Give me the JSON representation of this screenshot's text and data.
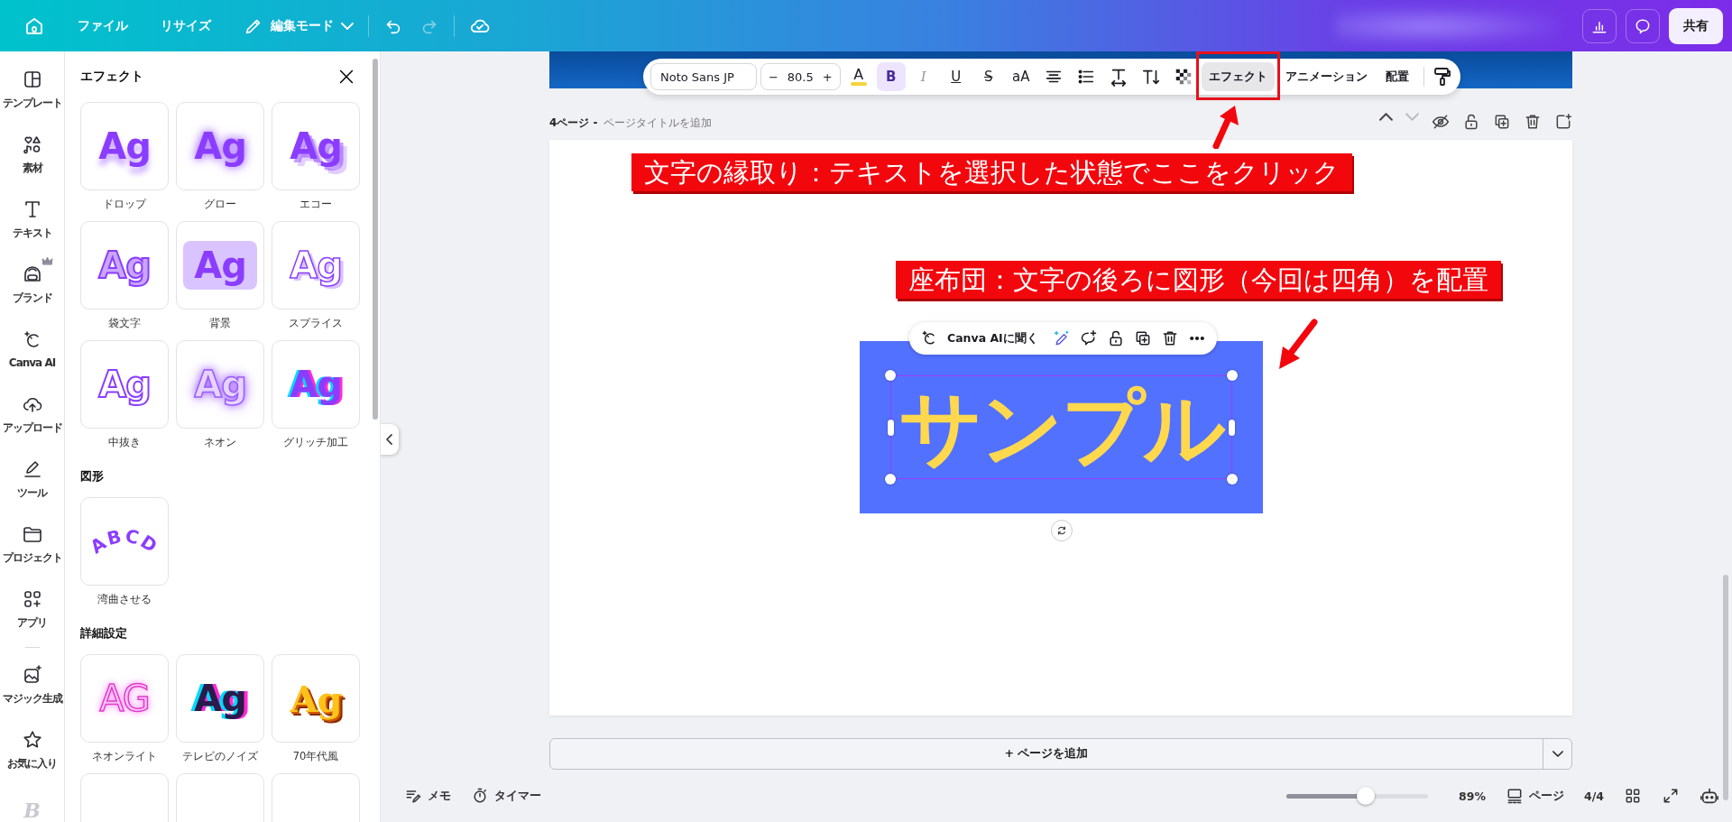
{
  "top_bar": {
    "menus": [
      "ファイル",
      "リサイズ"
    ],
    "edit_mode": "編集モード",
    "share": "共有"
  },
  "rail": {
    "items": [
      {
        "kind": "templates",
        "label": "テンプレート",
        "premium": false
      },
      {
        "kind": "elements",
        "label": "素材",
        "premium": false
      },
      {
        "kind": "text",
        "label": "テキスト",
        "premium": false
      },
      {
        "kind": "brand",
        "label": "ブランド",
        "premium": true
      },
      {
        "kind": "ai",
        "label": "Canva AI",
        "premium": false
      },
      {
        "kind": "upload",
        "label": "アップロード",
        "premium": false
      },
      {
        "kind": "tools",
        "label": "ツール",
        "premium": false
      },
      {
        "kind": "projects",
        "label": "プロジェクト",
        "premium": false
      },
      {
        "kind": "apps",
        "label": "アプリ",
        "premium": false
      },
      {
        "kind": "magic",
        "label": "マジック生成",
        "premium": false
      },
      {
        "kind": "favorites",
        "label": "お気に入り",
        "premium": false
      }
    ],
    "logo": "B"
  },
  "effects_panel": {
    "title": "エフェクト",
    "sections": [
      {
        "items": [
          {
            "kind": "drop",
            "preview": "Ag",
            "label": "ドロップ"
          },
          {
            "kind": "glow",
            "preview": "Ag",
            "label": "グロー"
          },
          {
            "kind": "echo",
            "preview": "Ag",
            "label": "エコー"
          },
          {
            "kind": "outline",
            "preview": "Ag",
            "label": "袋文字"
          },
          {
            "kind": "background",
            "preview": "Ag",
            "label": "背景"
          },
          {
            "kind": "splice",
            "preview": "Ag",
            "label": "スプライス"
          },
          {
            "kind": "hollow",
            "preview": "Ag",
            "label": "中抜き"
          },
          {
            "kind": "neon",
            "preview": "Ag",
            "label": "ネオン"
          },
          {
            "kind": "glitch",
            "preview": "Ag",
            "label": "グリッチ加工"
          }
        ]
      },
      {
        "heading": "図形",
        "items": [
          {
            "kind": "curve",
            "preview": "ABCD",
            "label": "湾曲させる"
          }
        ]
      },
      {
        "heading": "詳細設定",
        "items": [
          {
            "kind": "neonlight",
            "preview": "AG",
            "label": "ネオンライト"
          },
          {
            "kind": "tvnoise",
            "preview": "Ag",
            "label": "テレビのノイズ"
          },
          {
            "kind": "retro",
            "preview": "Ag",
            "label": "70年代風"
          },
          {
            "kind": "cut"
          },
          {
            "kind": "cut"
          },
          {
            "kind": "cut"
          }
        ]
      }
    ]
  },
  "text_toolbar": {
    "font": "Noto Sans JP",
    "minus": "−",
    "size": "80.5",
    "plus": "+",
    "tools": [
      {
        "kind": "color",
        "label": "A"
      },
      {
        "kind": "bold",
        "label": "B",
        "selected": true
      },
      {
        "kind": "italic",
        "label": "I",
        "selected": false
      },
      {
        "kind": "underline",
        "label": "U",
        "selected": false
      },
      {
        "kind": "strike",
        "label": "S",
        "selected": false
      },
      {
        "kind": "case",
        "label": "aA"
      },
      {
        "kind": "align"
      },
      {
        "kind": "list"
      },
      {
        "kind": "spacing"
      },
      {
        "kind": "vertical"
      },
      {
        "kind": "transparency"
      }
    ],
    "menus": [
      {
        "label": "エフェクト",
        "selected": true,
        "marked": true
      },
      {
        "label": "アニメーション",
        "selected": false,
        "marked": false
      },
      {
        "label": "配置",
        "selected": false,
        "marked": false
      }
    ]
  },
  "page_header": {
    "page": "4ページ -",
    "title_placeholder": "ページタイトルを追加"
  },
  "canvas": {
    "annotations": [
      {
        "text": "文字の縁取り：テキストを選択した状態でここをクリック"
      },
      {
        "text": "座布団：文字の後ろに図形（今回は四角）を配置"
      }
    ],
    "element_toolbar": {
      "ai_label": "Canva AIに聞く"
    },
    "sample_text": "サンプル"
  },
  "add_page": {
    "label": "+ ページを追加"
  },
  "bottom_bar": {
    "notes": "メモ",
    "timer": "タイマー",
    "zoom": {
      "level": 0.56
    },
    "zoom_reading": "89%",
    "pages": "ページ",
    "page_count": "4/4"
  }
}
